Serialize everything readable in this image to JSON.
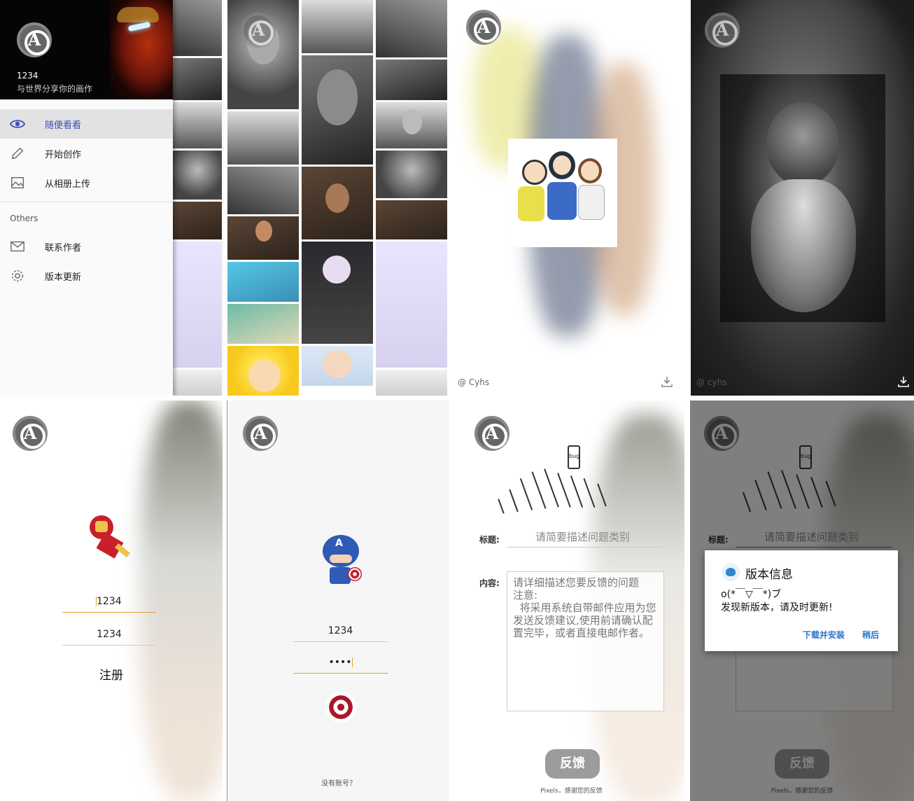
{
  "drawer": {
    "username": "1234",
    "motto": "与世界分享你的画作",
    "menu_items": [
      {
        "label": "随便看看",
        "icon": "eye-icon"
      },
      {
        "label": "开始创作",
        "icon": "pencil-icon"
      },
      {
        "label": "从相册上传",
        "icon": "image-icon"
      }
    ],
    "section_label": "Others",
    "other_items": [
      {
        "label": "联系作者",
        "icon": "mail-icon"
      },
      {
        "label": "版本更新",
        "icon": "gear-icon"
      }
    ]
  },
  "logo": {
    "glyph": "A",
    "icon": "avengers-logo-icon"
  },
  "detail_anime": {
    "attribution": "@ Cyhs"
  },
  "detail_bw": {
    "attribution": "@ cyhs"
  },
  "login": {
    "username_value": "1234",
    "password_value": "1234",
    "register_label": "注册"
  },
  "login2": {
    "username_value": "1234",
    "password_value": "••••",
    "no_account_label": "没有账号？"
  },
  "feedback": {
    "title_label": "标题:",
    "title_placeholder": "请简要描述问题类别",
    "content_label": "内容:",
    "content_placeholder": "请详细描述您要反馈的问题\n注意:\n  将采用系统自带邮件应用为您发送反馈建议,使用前请确认配置完毕，或者直接电邮作者。",
    "submit_label": "反馈",
    "footer_note": "Pixels，感谢您的反馈",
    "illustration_text": "bug"
  },
  "update_dialog": {
    "title": "版本信息",
    "message": "o(*￣▽￣*)ブ\n发现新版本，请及时更新!",
    "confirm_label": "下载并安装",
    "cancel_label": "稍后"
  },
  "colors": {
    "accent": "#3f51b5",
    "dialog_button": "#2c74c9",
    "focus_underline": "#e0a32e"
  }
}
